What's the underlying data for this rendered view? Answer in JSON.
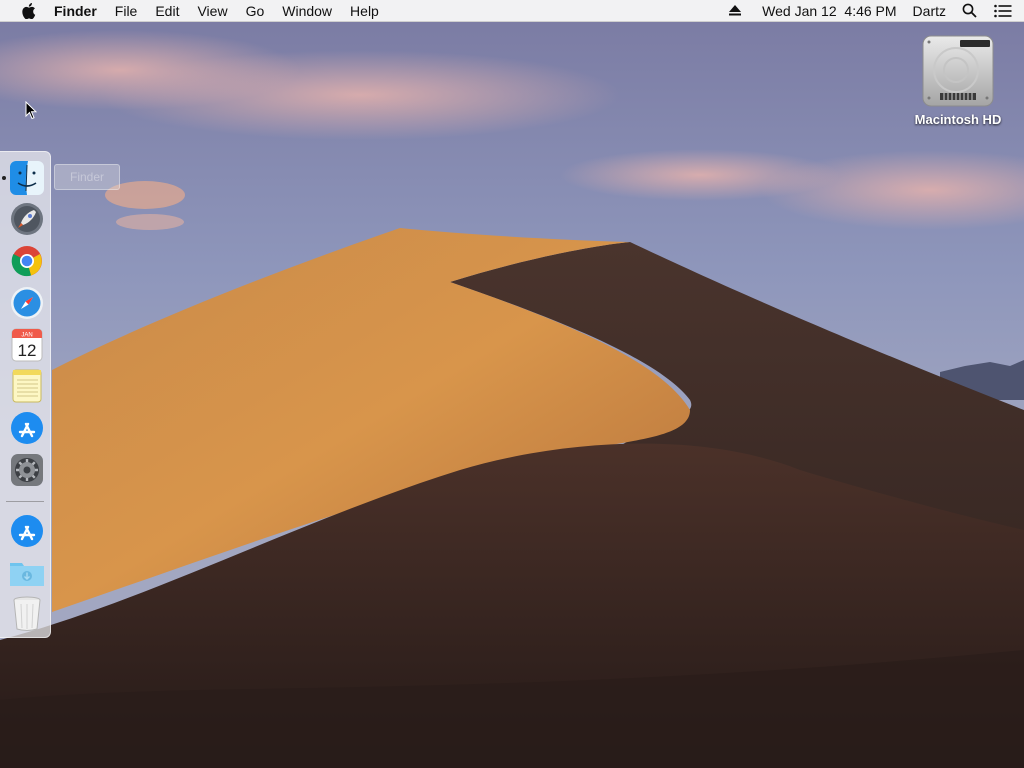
{
  "menubar": {
    "app_name": "Finder",
    "items": [
      "File",
      "Edit",
      "View",
      "Go",
      "Window",
      "Help"
    ],
    "datetime": "Wed Jan 12  4:46 PM",
    "user": "Dartz"
  },
  "desktop": {
    "icons": [
      {
        "label": "Macintosh HD",
        "icon": "hard-drive-icon"
      }
    ]
  },
  "dock": {
    "tooltip": "Finder",
    "apps": [
      {
        "name": "Finder",
        "icon": "finder-icon",
        "running": true
      },
      {
        "name": "Launchpad",
        "icon": "launchpad-rocket-icon",
        "running": false
      },
      {
        "name": "Google Chrome",
        "icon": "chrome-icon",
        "running": false
      },
      {
        "name": "Safari",
        "icon": "safari-compass-icon",
        "running": false
      },
      {
        "name": "Calendar",
        "icon": "calendar-icon",
        "running": false,
        "badge_month": "JAN",
        "badge_day": "12"
      },
      {
        "name": "Notes",
        "icon": "notes-icon",
        "running": false
      },
      {
        "name": "App Store",
        "icon": "app-store-icon",
        "running": false
      },
      {
        "name": "System Preferences",
        "icon": "gear-icon",
        "running": false
      }
    ],
    "others": [
      {
        "name": "App Store",
        "icon": "app-store-icon"
      },
      {
        "name": "Downloads",
        "icon": "downloads-folder-icon"
      },
      {
        "name": "Trash",
        "icon": "trash-icon"
      }
    ]
  },
  "colors": {
    "menubar_bg": "#f6f6f6",
    "sky_top": "#7d7ea6",
    "sky_bottom": "#a3a9c4",
    "dune_light": "#d4924a",
    "dune_shadow": "#3a2a26"
  }
}
